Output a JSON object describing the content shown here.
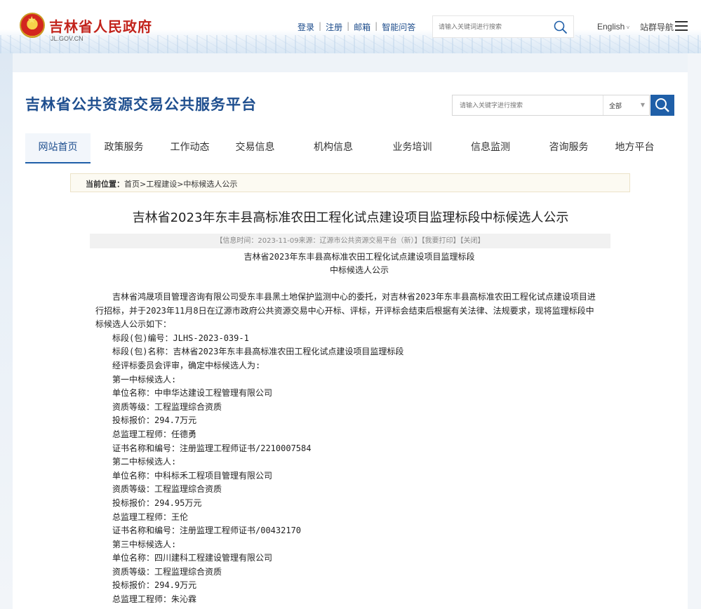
{
  "header": {
    "site_title": "吉林省人民政府",
    "site_domain": "JL.GOV.CN",
    "links": [
      "登录",
      "注册",
      "邮箱",
      "智能问答"
    ],
    "search_placeholder": "请输入关键词进行搜索",
    "language": "English",
    "sitemap": "站群导航"
  },
  "platform": {
    "title": "吉林省公共资源交易公共服务平台",
    "search_placeholder": "请输入关键字进行搜索",
    "scope_selected": "全部"
  },
  "nav": [
    {
      "label": "网站首页",
      "active": true
    },
    {
      "label": "政策服务"
    },
    {
      "label": "工作动态"
    },
    {
      "label": "交易信息"
    },
    {
      "label": "机构信息"
    },
    {
      "label": "业务培训"
    },
    {
      "label": "信息监测"
    },
    {
      "label": "咨询服务"
    },
    {
      "label": "地方平台"
    }
  ],
  "breadcrumb": {
    "label": "当前位置：",
    "path": "首页>工程建设>中标候选人公示"
  },
  "article": {
    "title": "吉林省2023年东丰县高标准农田工程化试点建设项目监理标段中标候选人公示",
    "meta_info": "【信息时间：2023-11-09来源：辽源市公共资源交易平台（新）】",
    "print": "【我要打印】",
    "close": "【关闭】",
    "subtitle_line1": "吉林省2023年东丰县高标准农田工程化试点建设项目监理标段",
    "subtitle_line2": "中标候选人公示",
    "intro": "吉林省鸿晟项目管理咨询有限公司受东丰县黑土地保护监测中心的委托，对吉林省2023年东丰县高标准农田工程化试点建设项目进行招标，并于2023年11月8日在辽源市政府公共资源交易中心开标、评标，开评标会结束后根据有关法律、法规要求，现将监理标段中标候选人公示如下：",
    "lines": [
      "标段(包)编号：JLHS-2023-039-1",
      "标段(包)名称：吉林省2023年东丰县高标准农田工程化试点建设项目监理标段",
      "经评标委员会评审，确定中标候选人为:",
      "第一中标候选人:",
      "单位名称：中申华达建设工程管理有限公司",
      "资质等级：工程监理综合资质",
      "投标报价：294.7万元",
      "总监理工程师：任德勇",
      "证书名称和编号：注册监理工程师证书/2210007584",
      "第二中标候选人:",
      "单位名称：中科标禾工程项目管理有限公司",
      "资质等级：工程监理综合资质",
      "投标报价：294.95万元",
      "总监理工程师：王伦",
      "证书名称和编号：注册监理工程师证书/00432170",
      "第三中标候选人:",
      "单位名称：四川建科工程建设管理有限公司",
      "资质等级：工程监理综合资质",
      "投标报价：294.9万元",
      "总监理工程师：朱沁霖"
    ]
  },
  "colors": {
    "brand_red": "#c2231b",
    "platform_blue": "#1f4f8f",
    "button_blue": "#1f5fa8"
  }
}
